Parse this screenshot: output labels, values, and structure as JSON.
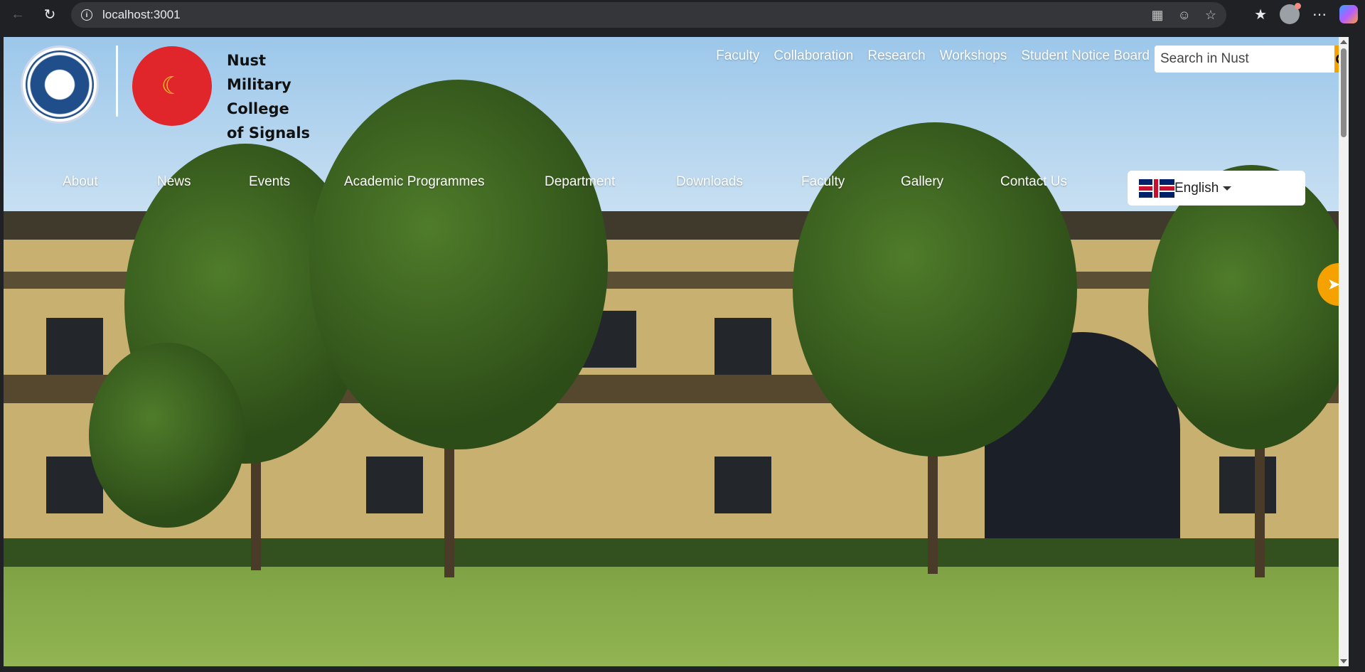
{
  "browser": {
    "url": "localhost:3001",
    "icons": [
      "back-arrow-icon",
      "reload-icon",
      "site-info-icon",
      "apps-icon",
      "reading-mode-icon",
      "favorite-star-icon",
      "favorites-icon",
      "profile-icon",
      "more-icon",
      "copilot-icon"
    ]
  },
  "site": {
    "college_name_lines": [
      "Nust",
      "Military",
      "College",
      "of Signals"
    ],
    "top_links": [
      "Faculty",
      "Collaboration",
      "Research",
      "Workshops",
      "Student Notice Board"
    ],
    "search_placeholder": "Search in Nust",
    "main_nav": [
      "About",
      "News",
      "Events",
      "Academic Programmes",
      "Department",
      "Downloads",
      "Faculty",
      "Gallery",
      "Contact Us"
    ],
    "language": "English",
    "colors": {
      "accent": "#f5a200",
      "mcs_red": "#e1262b",
      "nust_blue": "#1f4e8a"
    }
  }
}
